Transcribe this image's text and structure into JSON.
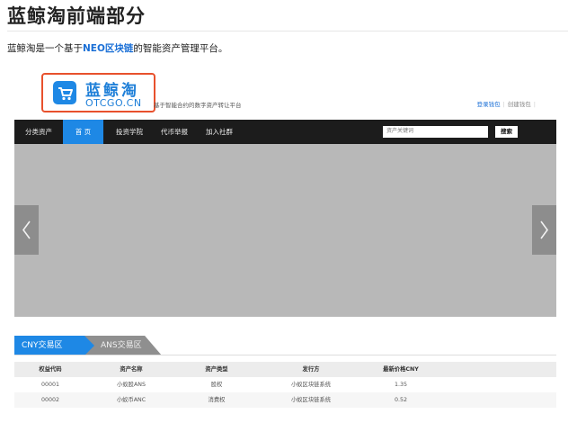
{
  "doc": {
    "title": "蓝鲸淘前端部分",
    "intro_prefix": "蓝鲸淘是一个基于",
    "intro_link": "NEO区块链",
    "intro_suffix": "的智能资产管理平台。"
  },
  "site": {
    "logo_name": "蓝鲸淘",
    "logo_sub": "OTCGO.CN",
    "slogan": "基于智能合约的数字资产转让平台",
    "login_link": "登录钱包",
    "create_link": "创建钱包",
    "nav": {
      "items": [
        {
          "label": "分类资产"
        },
        {
          "label": "首 页"
        },
        {
          "label": "投资学院"
        },
        {
          "label": "代币举报"
        },
        {
          "label": "加入社群"
        }
      ],
      "search_placeholder": "资产关键词",
      "search_button": "搜索"
    },
    "carousel": {
      "prev_symbol": "‹",
      "next_symbol": "›"
    },
    "tabs": [
      {
        "label": "CNY交易区"
      },
      {
        "label": "ANS交易区"
      }
    ],
    "table": {
      "headers": [
        "权益代码",
        "资产名称",
        "资产类型",
        "发行方",
        "最新价格CNY"
      ],
      "rows": [
        [
          "00001",
          "小蚁股ANS",
          "股权",
          "小蚁区块链系统",
          "1.35"
        ],
        [
          "00002",
          "小蚁币ANC",
          "消费权",
          "小蚁区块链系统",
          "0.52"
        ]
      ]
    }
  },
  "colors": {
    "accent": "#1e88e5",
    "highlight_border": "#e8512d",
    "nav_bg": "#1c1c1c",
    "carousel_bg": "#b8b8b8"
  }
}
